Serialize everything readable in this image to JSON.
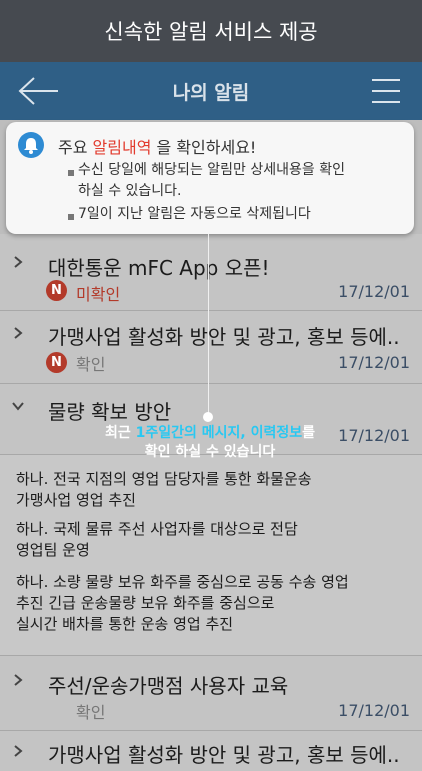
{
  "banner": {
    "title": "신속한 알림 서비스 제공"
  },
  "nav": {
    "title": "나의 알림"
  },
  "tooltip": {
    "prefix": "주요 ",
    "highlight": "알림내역",
    "suffix": " 을 확인하세요!",
    "bullet1_line1": "수신 당일에 해당되는 알림만 상세내용을 확인",
    "bullet1_line2": "하실 수 있습니다.",
    "bullet2": "7일이 지난 알림은 자동으로 삭제됩니다"
  },
  "callout": {
    "pre": "최근 ",
    "highlight": "1주일간의 메시지, 이력정보",
    "post": "를",
    "line2": "확인 하실 수 있습니다"
  },
  "items": [
    {
      "title": "대한통운 mFC App 오픈!",
      "badge": "N",
      "status": "미확인",
      "date": "17/12/01"
    },
    {
      "title": "가맹사업 활성화 방안 및 광고, 홍보 등에..",
      "badge": "N",
      "status": "확인",
      "date": "17/12/01"
    },
    {
      "title": "물량 확보 방안",
      "date": "17/12/01"
    },
    {
      "title": "주선/운송가맹점 사용자 교육",
      "status": "확인",
      "date": "17/12/01"
    },
    {
      "title": "가맹사업 활성화 방안 및 광고, 홍보 등에.."
    }
  ],
  "detail": {
    "p1_line1": "하나. 전국 지점의 영업 담당자를 통한 화물운송",
    "p1_line2": "가맹사업 영업 추진",
    "p2_line1": "하나. 국제 물류 주선 사업자를 대상으로 전담",
    "p2_line2": "영업팀 운영",
    "p3_line1": "하나. 소량 물량 보유 화주를 중심으로 공동 수송 영업",
    "p3_line2": "추진 긴급 운송물량 보유 화주를 중심으로",
    "p3_line3": "실시간 배차를 통한 운송 영업 추진"
  },
  "colors": {
    "banner": "#464a50",
    "navbar": "#2f5f86",
    "unread": "#b33a2a",
    "highlight_red": "#e23b2e",
    "highlight_cyan": "#28c8f2"
  }
}
